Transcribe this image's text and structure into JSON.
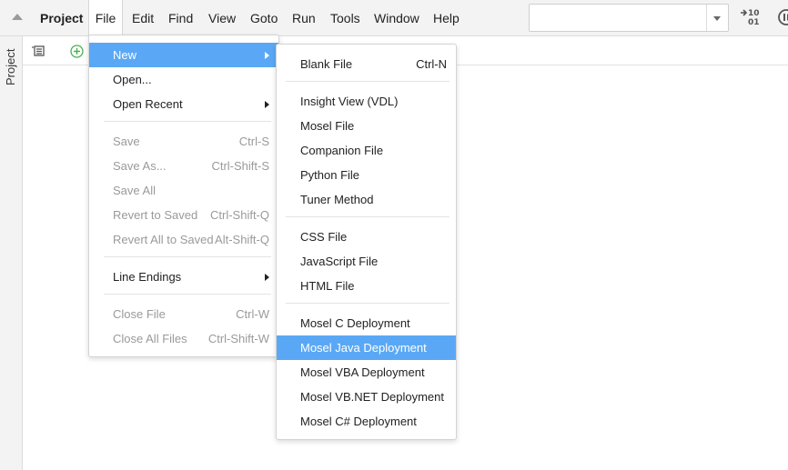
{
  "menubar": {
    "project_label": "Project",
    "items": [
      "File",
      "Edit",
      "Find",
      "View",
      "Goto",
      "Run",
      "Tools",
      "Window",
      "Help"
    ],
    "active_item": "File",
    "search": {
      "value": "",
      "placeholder": ""
    },
    "binary_icon_text_top": "10",
    "binary_icon_text_bottom": "01"
  },
  "side_panel": {
    "label": "Project"
  },
  "file_menu": {
    "new": {
      "label": "New"
    },
    "open": {
      "label": "Open..."
    },
    "open_recent": {
      "label": "Open Recent"
    },
    "save": {
      "label": "Save",
      "shortcut": "Ctrl-S"
    },
    "save_as": {
      "label": "Save As...",
      "shortcut": "Ctrl-Shift-S"
    },
    "save_all": {
      "label": "Save All"
    },
    "revert": {
      "label": "Revert to Saved",
      "shortcut": "Ctrl-Shift-Q"
    },
    "revert_all": {
      "label": "Revert All to Saved",
      "shortcut": "Alt-Shift-Q"
    },
    "line_endings": {
      "label": "Line Endings"
    },
    "close_file": {
      "label": "Close File",
      "shortcut": "Ctrl-W"
    },
    "close_all": {
      "label": "Close All Files",
      "shortcut": "Ctrl-Shift-W"
    }
  },
  "new_menu": {
    "blank_file": {
      "label": "Blank File",
      "shortcut": "Ctrl-N"
    },
    "insight_view": {
      "label": "Insight View (VDL)"
    },
    "mosel_file": {
      "label": "Mosel File"
    },
    "companion_file": {
      "label": "Companion File"
    },
    "python_file": {
      "label": "Python File"
    },
    "tuner_method": {
      "label": "Tuner Method"
    },
    "css_file": {
      "label": "CSS File"
    },
    "javascript_file": {
      "label": "JavaScript File"
    },
    "html_file": {
      "label": "HTML File"
    },
    "mosel_c": {
      "label": "Mosel C Deployment"
    },
    "mosel_java": {
      "label": "Mosel Java Deployment"
    },
    "mosel_vba": {
      "label": "Mosel VBA Deployment"
    },
    "mosel_vbnet": {
      "label": "Mosel VB.NET Deployment"
    },
    "mosel_csharp": {
      "label": "Mosel C# Deployment"
    }
  },
  "colors": {
    "highlight": "#5aa8f5",
    "disabled_text": "#9a9a9a",
    "add_icon": "#4caf50"
  }
}
